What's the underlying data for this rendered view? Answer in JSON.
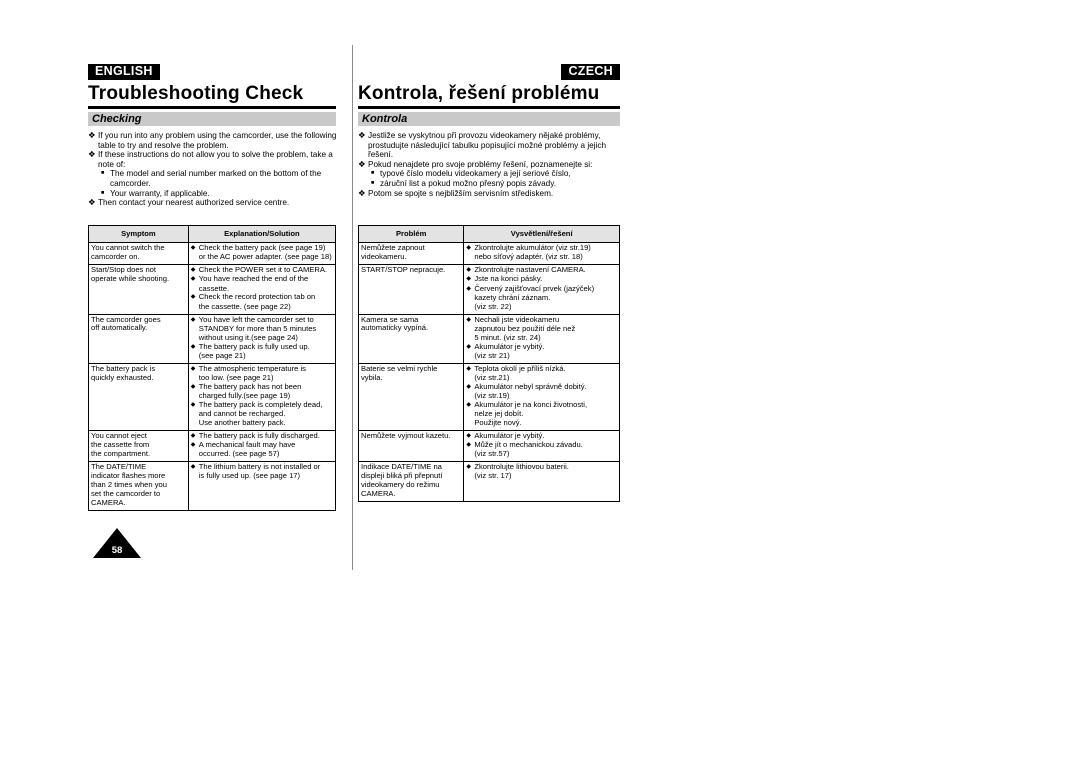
{
  "english": {
    "lang_tag": "ENGLISH",
    "title": "Troubleshooting Check",
    "section": "Checking",
    "intro": [
      {
        "mark": "❖",
        "text": "If you run into any problem using the camcorder, use the following table to try and resolve the problem.",
        "level": 1
      },
      {
        "mark": "❖",
        "text": "If these instructions do not allow you to solve the problem, take a note of:",
        "level": 1
      },
      {
        "mark": "■",
        "text": "The model and serial number marked on the bottom of the camcorder.",
        "level": 2
      },
      {
        "mark": "■",
        "text": "Your warranty, if applicable.",
        "level": 2
      },
      {
        "mark": "❖",
        "text": "Then contact your nearest authorized service centre.",
        "level": 1
      }
    ],
    "table": {
      "headers": [
        "Symptom",
        "Explanation/Solution"
      ],
      "rows": [
        {
          "symptom": [
            "You cannot switch the",
            "camcorder on."
          ],
          "solutions": [
            {
              "lines": [
                "Check the battery pack (see page 19)",
                "or the AC power adapter. (see page 18)"
              ]
            }
          ]
        },
        {
          "symptom": [
            "Start/Stop does not",
            "operate while shooting."
          ],
          "solutions": [
            {
              "lines": [
                "Check the POWER set it to CAMERA."
              ]
            },
            {
              "lines": [
                "You have reached the end of the",
                "cassette."
              ]
            },
            {
              "lines": [
                "Check the record protection tab on",
                "the cassette. (see page 22)"
              ]
            }
          ]
        },
        {
          "symptom": [
            "The camcorder goes",
            "off automatically."
          ],
          "solutions": [
            {
              "lines": [
                "You have left the camcorder set to",
                "STANDBY for more than 5 minutes",
                "without using it.(see page 24)"
              ]
            },
            {
              "lines": [
                "The battery pack is fully used up.",
                "(see page 21)"
              ]
            }
          ]
        },
        {
          "symptom": [
            "The battery pack is",
            "quickly exhausted."
          ],
          "solutions": [
            {
              "lines": [
                "The atmospheric temperature is",
                "too low. (see page 21)"
              ]
            },
            {
              "lines": [
                "The battery pack has not been",
                "charged fully.(see page 19)"
              ]
            },
            {
              "lines": [
                "The battery pack is completely dead,",
                "and cannot  be recharged.",
                "Use another battery pack."
              ]
            }
          ]
        },
        {
          "symptom": [
            "You cannot eject",
            "the cassette from",
            "the compartment."
          ],
          "solutions": [
            {
              "lines": [
                "The battery pack is fully discharged."
              ]
            },
            {
              "lines": [
                "A mechanical fault may have",
                "occurred. (see page 57)"
              ]
            }
          ]
        },
        {
          "symptom": [
            "The DATE/TIME",
            "indicator flashes more",
            "than 2 times when you",
            "set the camcorder to",
            "CAMERA."
          ],
          "solutions": [
            {
              "lines": [
                "The lithium battery is not installed or",
                "is fully used up. (see page 17)"
              ]
            }
          ]
        }
      ]
    }
  },
  "czech": {
    "lang_tag": "CZECH",
    "title": "Kontrola, řešení problému",
    "section": "Kontrola",
    "intro": [
      {
        "mark": "❖",
        "text": "Jestliže se vyskytnou při provozu videokamery nějaké problémy, prostudujte následující tabulku popisující možné problémy a jejich řešení.",
        "level": 1
      },
      {
        "mark": "❖",
        "text": "Pokud nenajdete pro svoje problémy řešení, poznamenejte si:",
        "level": 1
      },
      {
        "mark": "■",
        "text": "typové číslo modelu videokamery a její seriové číslo,",
        "level": 2
      },
      {
        "mark": "■",
        "text": "záruční list a pokud možno přesný popis závady.",
        "level": 2
      },
      {
        "mark": "❖",
        "text": "Potom se spojte s nejbližším servisním střediskem.",
        "level": 1
      }
    ],
    "table": {
      "headers": [
        "Problém",
        "Vysvětlení/řešení"
      ],
      "rows": [
        {
          "symptom": [
            "Nemůžete zapnout",
            "videokameru."
          ],
          "solutions": [
            {
              "lines": [
                "Zkontrolujte akumulátor (viz str.19)",
                "nebo síťový adaptér. (viz str. 18)"
              ]
            }
          ]
        },
        {
          "symptom": [
            "START/STOP nepracuje."
          ],
          "solutions": [
            {
              "lines": [
                "Zkontrolujte nastavení CAMERA."
              ]
            },
            {
              "lines": [
                "Jste na konci pásky."
              ]
            },
            {
              "lines": [
                "Červený zajišťovací prvek (jazýček)",
                "kazety chrání záznam.",
                "(viz str. 22)"
              ]
            }
          ]
        },
        {
          "symptom": [
            "Kamera se sama",
            "automaticky vypíná."
          ],
          "solutions": [
            {
              "lines": [
                "Nechali jste videokameru",
                "zapnutou bez použití déle než",
                "5 minut. (viz str. 24)"
              ]
            },
            {
              "lines": [
                "Akumulátor je vybitý.",
                "(viz str 21)"
              ]
            }
          ]
        },
        {
          "symptom": [
            "Baterie se velmi rychle",
            "vybila."
          ],
          "solutions": [
            {
              "lines": [
                "Teplota okolí je příliš nízká.",
                "(viz str.21)"
              ]
            },
            {
              "lines": [
                "Akumulátor nebyl správně dobitý.",
                "(viz str.19)"
              ]
            },
            {
              "lines": [
                "Akumulátor je na konci životnosti,",
                "nelze jej dobít.",
                "Použijte nový."
              ]
            }
          ]
        },
        {
          "symptom": [
            "Nemůžete vyjmout kazetu."
          ],
          "solutions": [
            {
              "lines": [
                "Akumulátor je vybitý."
              ]
            },
            {
              "lines": [
                "Může jít o mechanickou závadu.",
                "(viz str.57)"
              ]
            }
          ]
        },
        {
          "symptom": [
            "Indikace DATE/TIME na",
            "displeji bliká při přepnutí",
            "videokamery do režimu",
            "CAMERA."
          ],
          "solutions": [
            {
              "lines": [
                "Zkontrolujte lithiovou baterii.",
                "(viz str. 17)"
              ]
            }
          ]
        }
      ]
    }
  },
  "page_number": "58",
  "bullets": {
    "club": "❖",
    "square": "■",
    "diamond": "◆"
  }
}
